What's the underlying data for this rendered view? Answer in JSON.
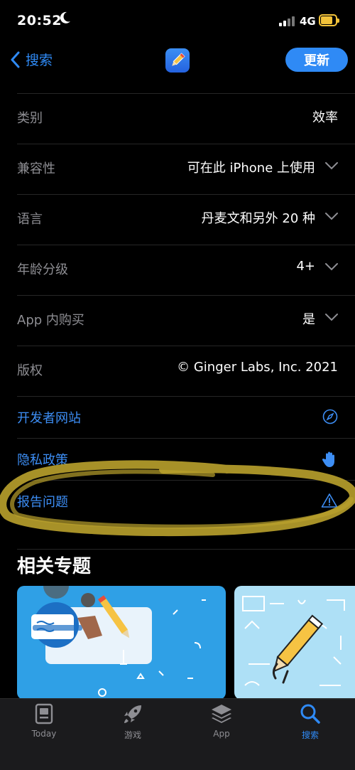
{
  "status": {
    "time": "20:52",
    "network": "4G"
  },
  "nav": {
    "back_label": "搜索",
    "update_label": "更新"
  },
  "info_rows": [
    {
      "label": "类别",
      "value": "效率",
      "expandable": false
    },
    {
      "label": "兼容性",
      "value": "可在此 iPhone 上使用",
      "expandable": true
    },
    {
      "label": "语言",
      "value": "丹麦文和另外 20 种",
      "expandable": true
    },
    {
      "label": "年龄分级",
      "value": "4+",
      "expandable": true
    },
    {
      "label": "App 内购买",
      "value": "是",
      "expandable": true
    },
    {
      "label": "版权",
      "value": "© Ginger Labs, Inc. 2021",
      "expandable": false
    }
  ],
  "links": [
    {
      "label": "开发者网站",
      "icon": "compass-icon"
    },
    {
      "label": "隐私政策",
      "icon": "hand-icon"
    },
    {
      "label": "报告问题",
      "icon": "warning-icon"
    }
  ],
  "related": {
    "title": "相关专题"
  },
  "tabs": [
    {
      "label": "Today",
      "icon": "today-icon",
      "active": false
    },
    {
      "label": "游戏",
      "icon": "rocket-icon",
      "active": false
    },
    {
      "label": "App",
      "icon": "layers-icon",
      "active": false
    },
    {
      "label": "搜索",
      "icon": "search-icon",
      "active": true
    }
  ],
  "colors": {
    "accent": "#2f8af5",
    "annotation": "#b9a12c",
    "battery": "#f3c33a"
  }
}
